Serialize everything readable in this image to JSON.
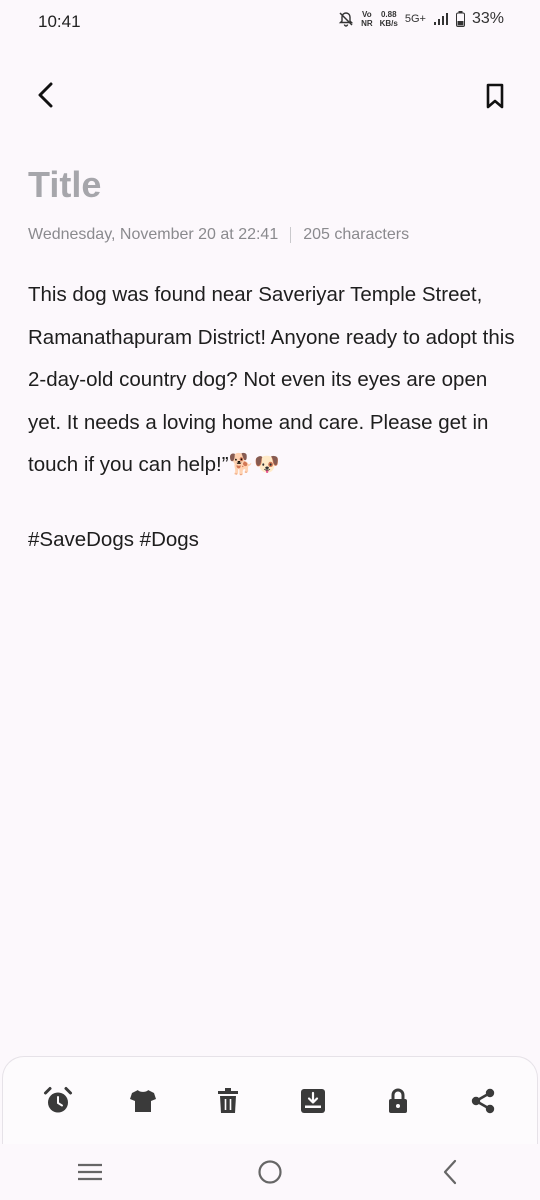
{
  "status_bar": {
    "time": "10:41",
    "vo_top": "Vo",
    "vo_bottom": "NR",
    "speed_top": "0.88",
    "speed_bottom": "KB/s",
    "network": "5G+",
    "battery": "33%"
  },
  "header": {
    "back_icon": "chevron-left-icon",
    "bookmark_icon": "bookmark-icon"
  },
  "note": {
    "title_placeholder": "Title",
    "date": "Wednesday, November 20 at 22:41",
    "char_count": "205 characters",
    "body": "This dog was found near Saveriyar Temple Street, Ramanathapuram District!   Anyone ready to adopt this 2-day-old country dog?  Not even its eyes are open yet.   It needs a loving home and care.   Please get in touch if you can help!”🐕🐶",
    "hashtags": "#SaveDogs #Dogs"
  },
  "toolbar": {
    "items": [
      "alarm-icon",
      "shirt-icon",
      "trash-icon",
      "save-icon",
      "lock-icon",
      "share-icon"
    ]
  },
  "nav": {
    "items": [
      "recent-apps-icon",
      "home-icon",
      "back-icon"
    ]
  }
}
